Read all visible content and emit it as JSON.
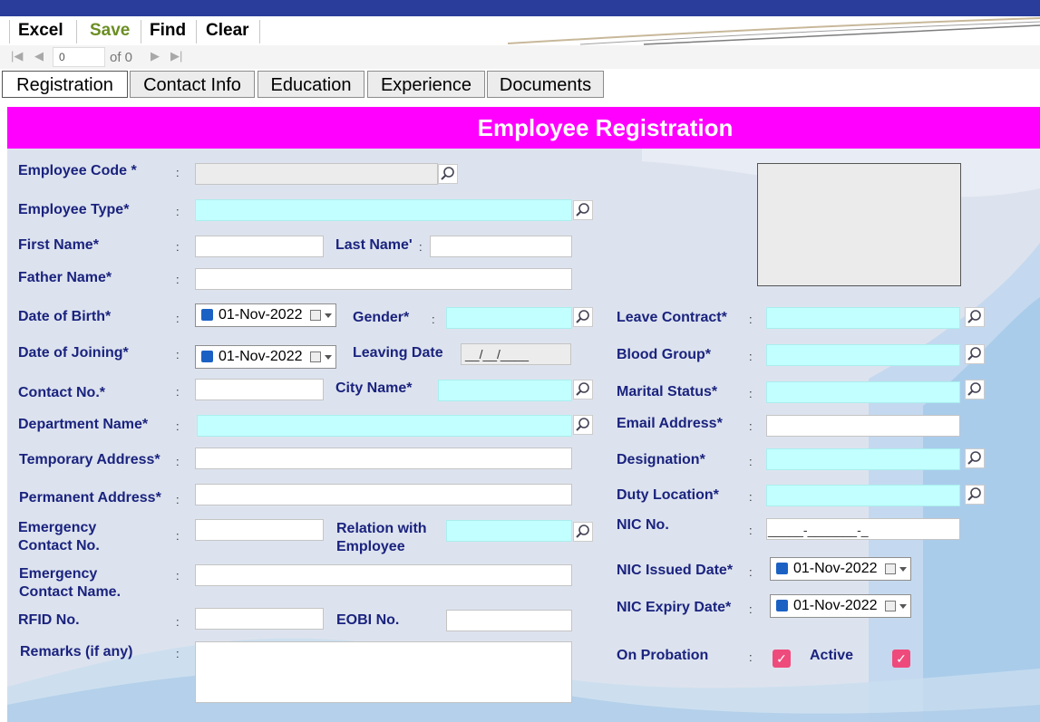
{
  "toolbar": {
    "excel": "Excel",
    "save": "Save",
    "find": "Find",
    "clear": "Clear"
  },
  "navigator": {
    "position": "0",
    "of_label": "of 0"
  },
  "tabs": [
    "Registration",
    "Contact Info",
    "Education",
    "Experience",
    "Documents"
  ],
  "form_title": "Employee Registration",
  "labels": {
    "employee_code": "Employee Code *",
    "employee_type": "Employee Type*",
    "first_name": "First Name*",
    "last_name": "Last Name'",
    "father_name": "Father Name*",
    "dob": "Date of Birth*",
    "gender": "Gender*",
    "leave_contract": "Leave Contract*",
    "doj": "Date of Joining*",
    "leaving_date": "Leaving Date",
    "blood_group": "Blood Group*",
    "contact_no": "Contact No.*",
    "city_name": "City Name*",
    "marital_status": "Marital Status*",
    "department_name": "Department Name*",
    "email": "Email Address*",
    "temp_address": "Temporary Address*",
    "designation": "Designation*",
    "perm_address": "Permanent Address*",
    "duty_location": "Duty Location*",
    "emergency_contact_no_1": "Emergency",
    "emergency_contact_no_2": "Contact No.",
    "relation_1": "Relation with",
    "relation_2": "Employee",
    "nic_no": "NIC No.",
    "emergency_contact_name_1": "Emergency",
    "emergency_contact_name_2": "Contact Name.",
    "nic_issued": "NIC Issued Date*",
    "nic_expiry": "NIC Expiry Date*",
    "rfid": "RFID No.",
    "eobi": "EOBI No.",
    "remarks": "Remarks (if any)",
    "on_probation": "On Probation",
    "active": "Active"
  },
  "values": {
    "dob": "01-Nov-2022",
    "doj": "01-Nov-2022",
    "nic_issued": "01-Nov-2022",
    "nic_expiry": "01-Nov-2022",
    "leaving_date_mask": "__/__/____",
    "nic_mask": "_____-_______-_"
  },
  "colon": ":",
  "colors": {
    "topbar": "#2b3d9b",
    "title_bg": "#ff00ff",
    "label": "#1a237e",
    "required_field": "#c2ffff",
    "checkbox": "#ef4a7c"
  }
}
